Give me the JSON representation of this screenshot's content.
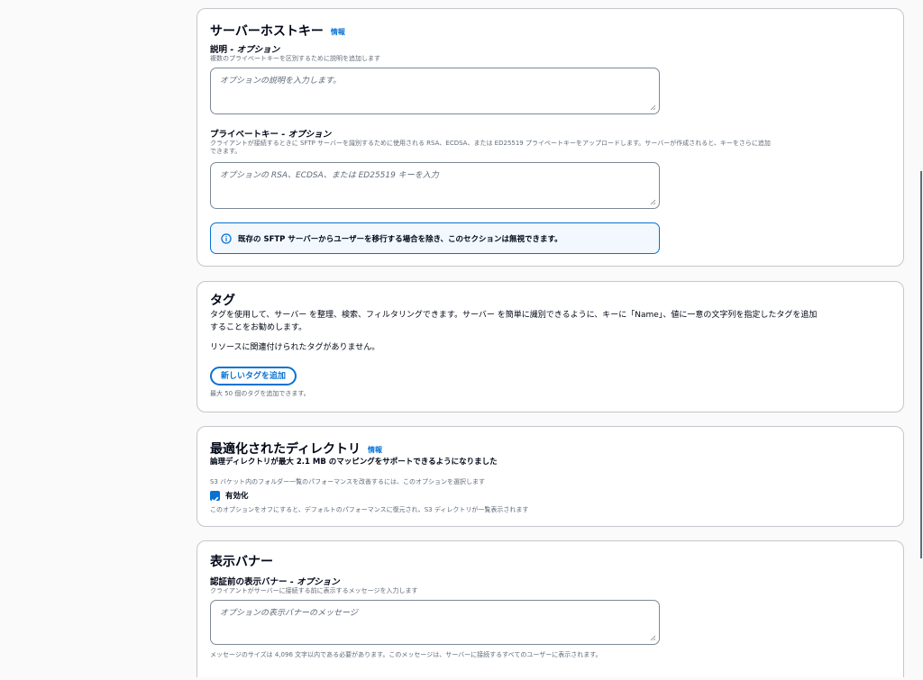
{
  "host_key": {
    "title": "サーバーホストキー",
    "info": "情報",
    "description_label": "説明",
    "description_optional": " - オプション",
    "description_help": "複数のプライベートキーを区別するために説明を追加します",
    "description_placeholder": "オプションの説明を入力します。",
    "private_key_label": "プライベートキー",
    "private_key_optional": " - オプション",
    "private_key_help_1": "クライアントが接続するときに SFTP サーバーを識別するために使用される RSA、ECDSA、または ED25519 プライベートキーをアップロードします。サーバーが作成されると、キーをさらに追加",
    "private_key_help_2": "できます。",
    "private_key_placeholder": "オプションの RSA、ECDSA、または ED25519 キーを入力",
    "alert_text": "既存の SFTP サーバーからユーザーを移行する場合を除き、このセクションは無視できます。"
  },
  "tags": {
    "title": "タグ",
    "desc_1": "タグを使用して、サーバー を整理、検索、フィルタリングできます。サーバー を簡単に識別できるように、キーに「Name」、値に一意の文字列を指定したタグを追加",
    "desc_2": "することをお勧めします。",
    "empty": "リソースに関連付けられたタグがありません。",
    "add_button": "新しいタグを追加",
    "limit": "最大 50 個のタグを追加できます。"
  },
  "optimized_dir": {
    "title": "最適化されたディレクトリ",
    "info": "情報",
    "subtitle": "論理ディレクトリが最大 2.1 MB のマッピングをサポートできるようになりました",
    "help": "S3 バケット内のフォルダー一覧のパフォーマンスを改善するには、このオプションを選択します",
    "checkbox_label": "有効化",
    "checkbox_checked": true,
    "note": "このオプションをオフにすると、デフォルトのパフォーマンスに復元され、S3 ディレクトリが一覧表示されます"
  },
  "banner": {
    "title": "表示バナー",
    "label": "認証前の表示バナー",
    "optional": " - オプション",
    "help": "クライアントがサーバーに接続する前に表示するメッセージを入力します",
    "placeholder": "オプションの表示バナーのメッセージ",
    "note": "メッセージのサイズは 4,096 文字以内である必要があります。このメッセージは、サーバーに接続するすべてのユーザーに表示されます。"
  },
  "colors": {
    "accent": "#0972d3",
    "border": "#c6c6cd",
    "text": "#000716",
    "muted": "#5f6b7a",
    "alert_bg": "#f2f8fd"
  }
}
